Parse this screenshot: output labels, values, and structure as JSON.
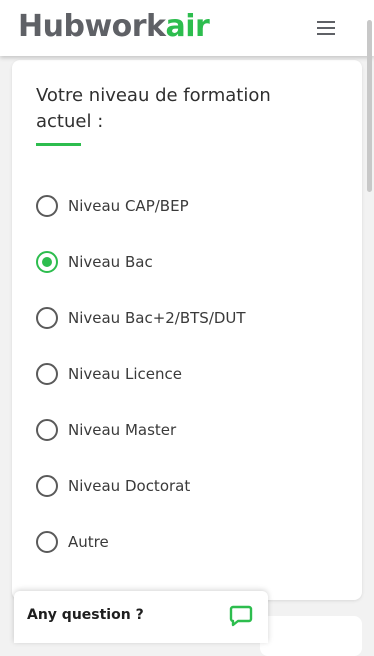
{
  "header": {
    "logo_part1": "Hubwork",
    "logo_part2": "air",
    "menu_icon": "hamburger-menu-icon"
  },
  "colors": {
    "accent": "#2dbd4e",
    "logo_grey": "#5f6166",
    "text": "#2f2f2f"
  },
  "form": {
    "question": "Votre niveau de formation actuel :",
    "options": [
      {
        "label": "Niveau CAP/BEP",
        "selected": false
      },
      {
        "label": "Niveau Bac",
        "selected": true
      },
      {
        "label": "Niveau Bac+2/BTS/DUT",
        "selected": false
      },
      {
        "label": "Niveau Licence",
        "selected": false
      },
      {
        "label": "Niveau Master",
        "selected": false
      },
      {
        "label": "Niveau Doctorat",
        "selected": false
      },
      {
        "label": "Autre",
        "selected": false
      }
    ]
  },
  "chat": {
    "label": "Any question ?",
    "icon": "chat-bubble-icon"
  }
}
